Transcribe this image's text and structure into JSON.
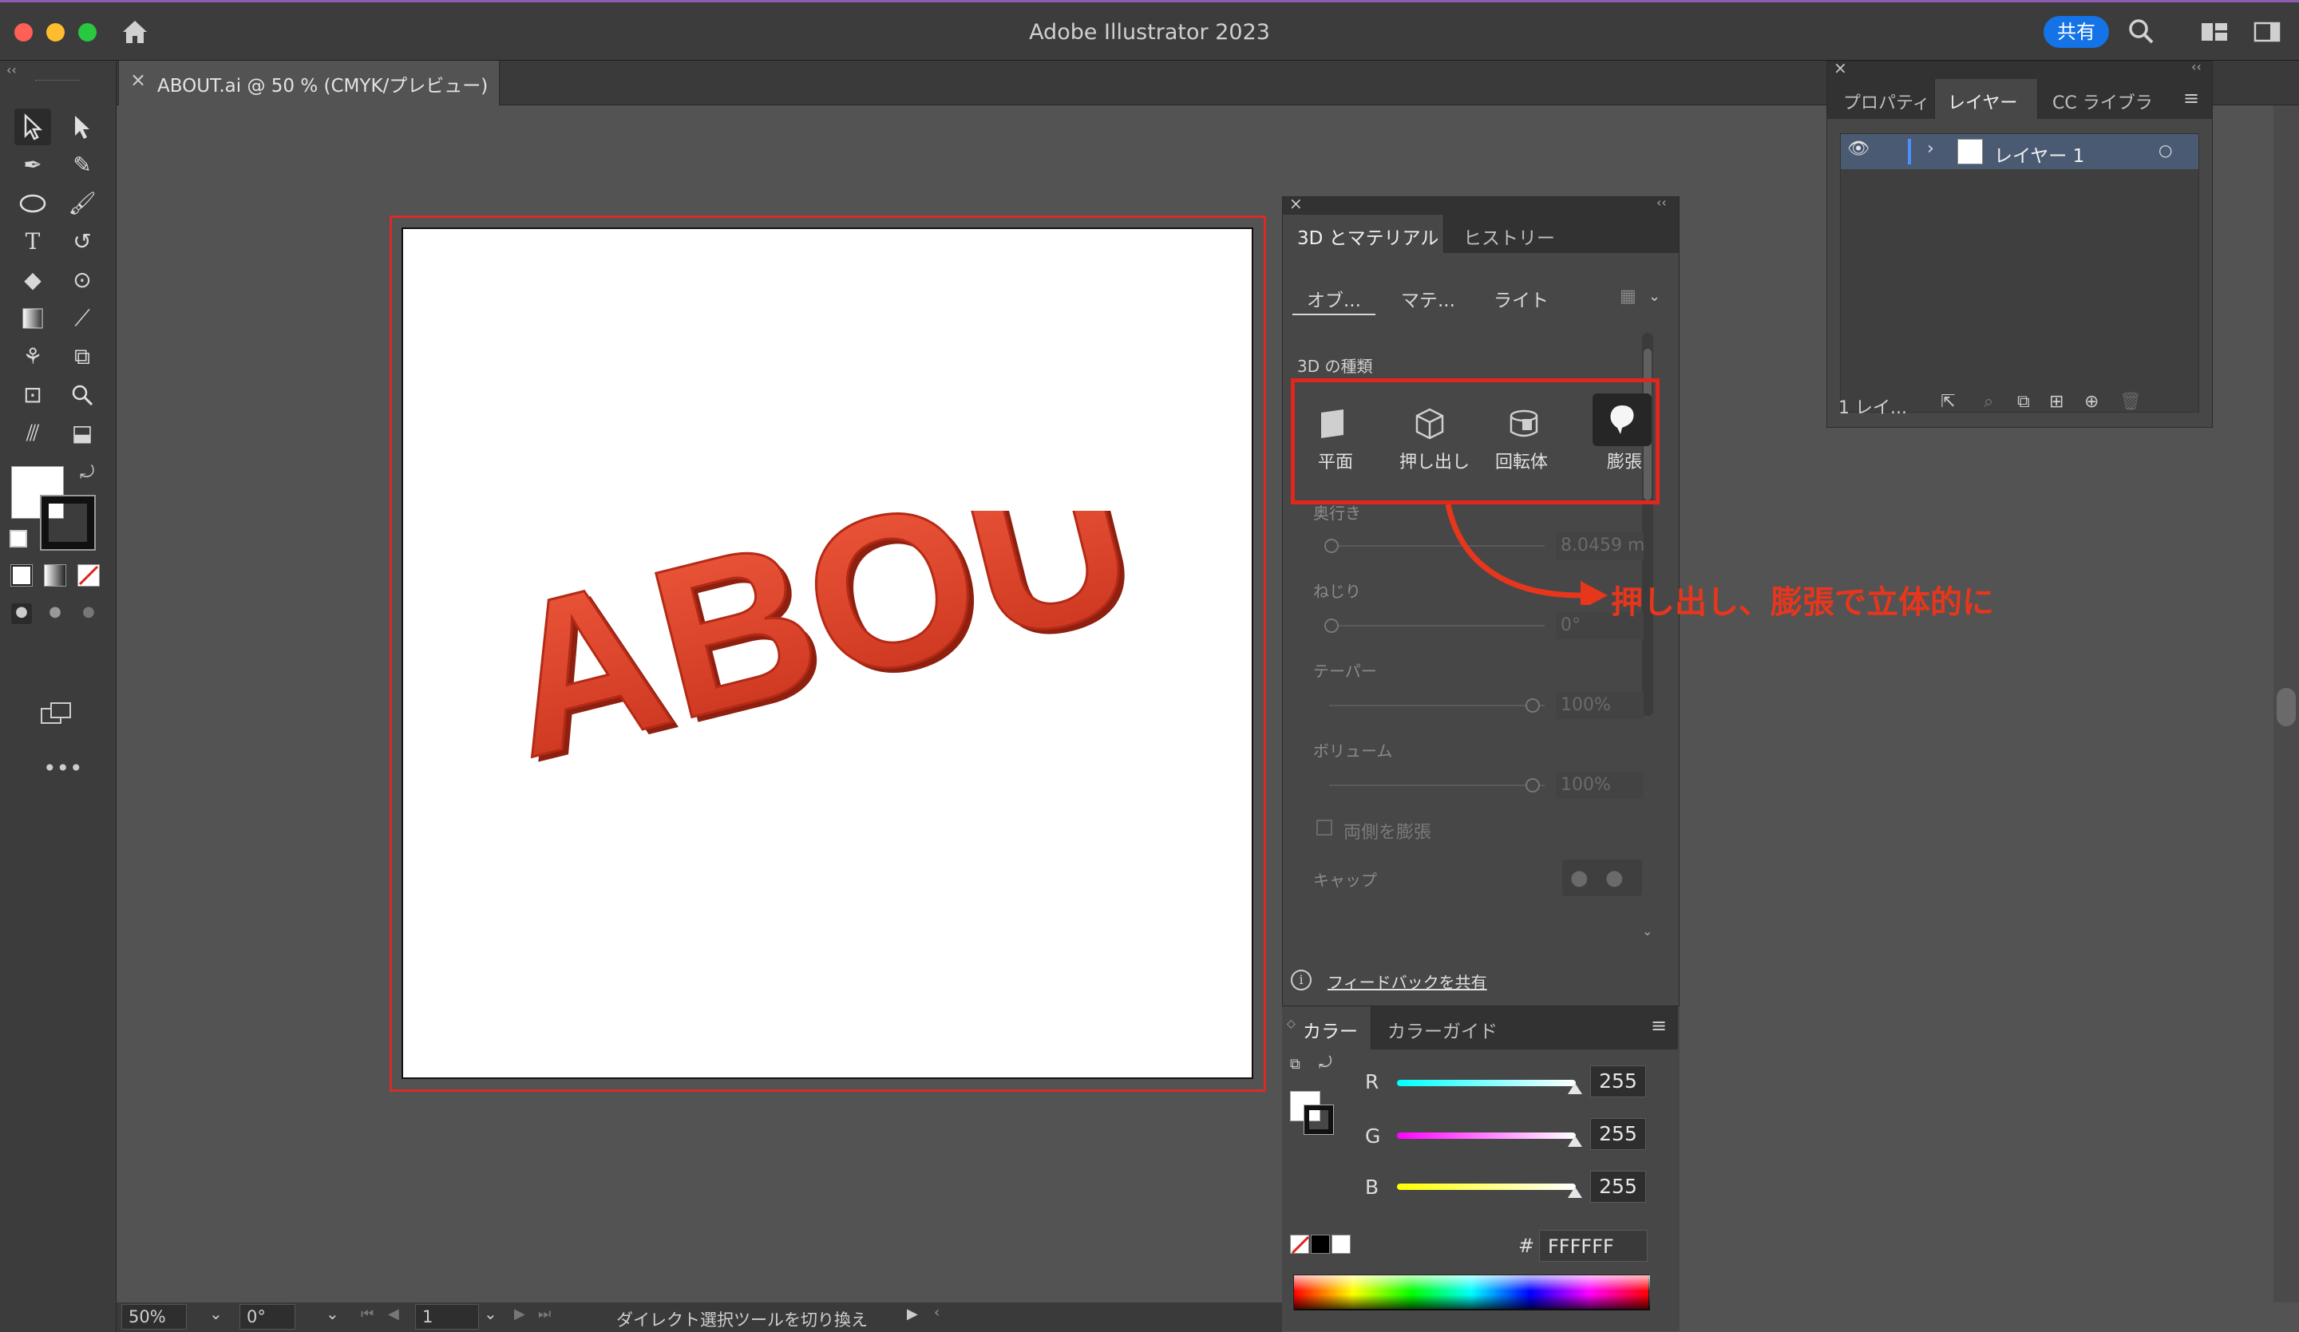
{
  "window": {
    "title": "Adobe Illustrator 2023",
    "share_label": "共有"
  },
  "document_tab": {
    "label": "ABOUT.ai @ 50 % (CMYK/プレビュー)",
    "close": "×"
  },
  "artwork": {
    "text": "ABOUT",
    "color": "#e2442a"
  },
  "panel_3d": {
    "tabs": [
      "3D とマテリアル",
      "ヒストリー"
    ],
    "subtabs": [
      "オブ...",
      "マテ...",
      "ライト"
    ],
    "section_label": "3D の種類",
    "types": [
      "平面",
      "押し出し",
      "回転体",
      "膨張"
    ],
    "selected_type": "膨張",
    "depth_label": "奥行き",
    "depth_value": "8.0459 m",
    "twist_label": "ねじり",
    "twist_value": "0°",
    "taper_label": "テーパー",
    "taper_value": "100%",
    "volume_label": "ボリューム",
    "volume_value": "100%",
    "both_sides_label": "両側を膨張",
    "cap_label": "キャップ",
    "feedback_label": "フィードバックを共有"
  },
  "annotation": {
    "text": "押し出し、膨張で立体的に",
    "color": "#e8361c"
  },
  "layers_panel": {
    "tabs": [
      "プロパティ",
      "レイヤー",
      "CC ライブラ"
    ],
    "active_tab": "レイヤー",
    "layer_name": "レイヤー 1",
    "footer_count": "1 レイ..."
  },
  "color_panel": {
    "tabs": [
      "カラー",
      "カラーガイド"
    ],
    "r_label": "R",
    "g_label": "G",
    "b_label": "B",
    "r": "255",
    "g": "255",
    "b": "255",
    "hash": "#",
    "hex": "FFFFFF"
  },
  "status": {
    "zoom": "50%",
    "rotation": "0°",
    "artboard": "1",
    "tool_hint": "ダイレクト選択ツールを切り換え"
  }
}
